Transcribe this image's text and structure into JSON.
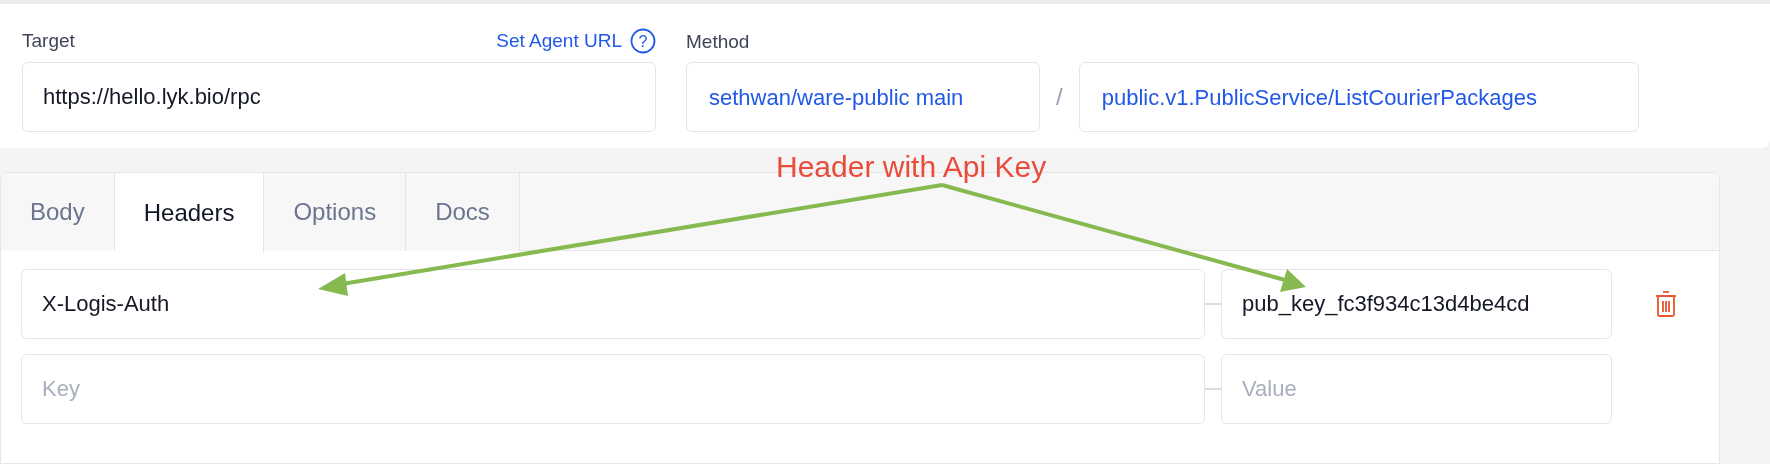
{
  "target": {
    "label": "Target",
    "agent_link": "Set Agent URL",
    "help": "?",
    "value": "https://hello.lyk.bio/rpc"
  },
  "method": {
    "label": "Method",
    "repository": "sethwan/ware-public main",
    "separator": "/",
    "service": "public.v1.PublicService/ListCourierPackages"
  },
  "tabs": [
    {
      "label": "Body",
      "selected": false
    },
    {
      "label": "Headers",
      "selected": true
    },
    {
      "label": "Options",
      "selected": false
    },
    {
      "label": "Docs",
      "selected": false
    }
  ],
  "headers": [
    {
      "key": "X-Logis-Auth",
      "value": "pub_key_fc3f934c13d4be4cd",
      "deletable": true
    },
    {
      "key_placeholder": "Key",
      "value_placeholder": "Value",
      "deletable": false
    }
  ],
  "annotation": {
    "text": "Header with Api Key"
  }
}
